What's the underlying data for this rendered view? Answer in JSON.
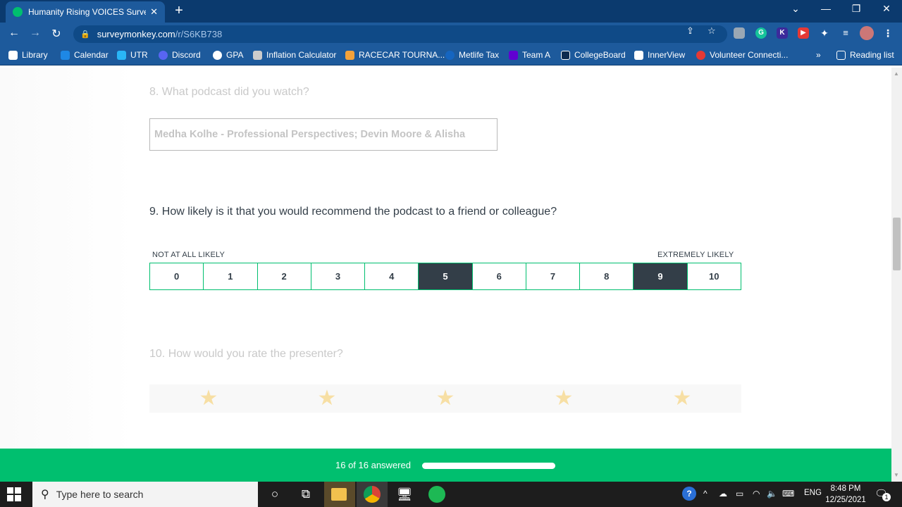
{
  "browser": {
    "tab_title": "Humanity Rising VOICES Survey",
    "url_host": "surveymonkey.com",
    "url_path": "/r/S6KB738",
    "bookmarks": [
      {
        "label": "Library",
        "color": "#ffffff"
      },
      {
        "label": "Calendar",
        "color": "#1e88e5"
      },
      {
        "label": "UTR",
        "color": "#29b6f6"
      },
      {
        "label": "Discord",
        "color": "#5865f2"
      },
      {
        "label": "GPA",
        "color": "#ffffff"
      },
      {
        "label": "Inflation Calculator",
        "color": "#cccccc"
      },
      {
        "label": "RACECAR TOURNA...",
        "color": "#f4a23a"
      },
      {
        "label": "Metlife Tax",
        "color": "#1565c0"
      },
      {
        "label": "Team A",
        "color": "#6001d2"
      },
      {
        "label": "CollegeBoard",
        "color": "#0d2a4f"
      },
      {
        "label": "InnerView",
        "color": "#ffffff"
      },
      {
        "label": "Volunteer Connecti...",
        "color": "#e53935"
      }
    ],
    "reading_list": "Reading list",
    "more_bookmarks": "»"
  },
  "survey": {
    "q8": {
      "label": "8. What podcast did you watch?",
      "value": "Medha Kolhe - Professional Perspectives; Devin Moore & Alisha"
    },
    "q9": {
      "label": "9. How likely is it that you would recommend the podcast to a friend or colleague?",
      "low_label": "NOT AT ALL LIKELY",
      "high_label": "EXTREMELY LIKELY",
      "options": [
        {
          "label": "0",
          "selected": false
        },
        {
          "label": "1",
          "selected": false
        },
        {
          "label": "2",
          "selected": false
        },
        {
          "label": "3",
          "selected": false
        },
        {
          "label": "4",
          "selected": false
        },
        {
          "label": "5",
          "selected": true
        },
        {
          "label": "6",
          "selected": false
        },
        {
          "label": "7",
          "selected": false
        },
        {
          "label": "8",
          "selected": false
        },
        {
          "label": "9",
          "selected": true
        },
        {
          "label": "10",
          "selected": false
        }
      ]
    },
    "q10": {
      "label": "10. How would you rate the presenter?",
      "stars": 5
    },
    "progress": {
      "text": "16 of 16 answered",
      "fraction": 1.0
    }
  },
  "taskbar": {
    "search_placeholder": "Type here to search",
    "language": "ENG",
    "time": "8:48 PM",
    "date": "12/25/2021",
    "notification_count": "1"
  },
  "colors": {
    "brand_green": "#00bf6f",
    "selected_dark": "#333e48",
    "chrome_blue": "#1d5a9c"
  }
}
